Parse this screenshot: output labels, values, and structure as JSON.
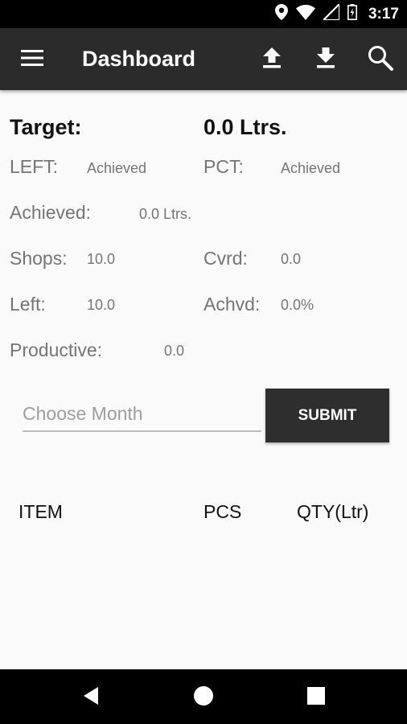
{
  "status_bar": {
    "time": "3:17"
  },
  "app_bar": {
    "title": "Dashboard"
  },
  "summary": {
    "target_label": "Target:",
    "target_value": "0.0 Ltrs.",
    "left_label": "LEFT:",
    "left_value": "Achieved",
    "pct_label": "PCT:",
    "pct_value": "Achieved",
    "achieved_label": "Achieved:",
    "achieved_value": "0.0 Ltrs.",
    "shops_label": "Shops:",
    "shops_value": "10.0",
    "cvrd_label": "Cvrd:",
    "cvrd_value": "0.0",
    "left2_label": "Left:",
    "left2_value": "10.0",
    "achvd_label": "Achvd:",
    "achvd_value": "0.0%",
    "productive_label": "Productive:",
    "productive_value": "0.0"
  },
  "month_picker": {
    "placeholder": "Choose Month",
    "value": ""
  },
  "submit_label": "SUBMIT",
  "table": {
    "headers": [
      "ITEM",
      "PCS",
      "QTY(Ltr)"
    ],
    "rows": []
  },
  "icons": {
    "menu": "menu-icon",
    "upload": "upload-icon",
    "download": "download-icon",
    "search": "search-icon"
  }
}
